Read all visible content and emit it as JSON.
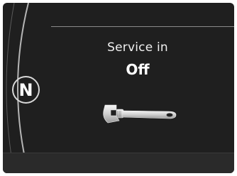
{
  "cluster": {
    "gear_indicator": "N",
    "service": {
      "label": "Service in",
      "value": "Off"
    },
    "icons": {
      "wrench": "wrench-icon"
    }
  }
}
